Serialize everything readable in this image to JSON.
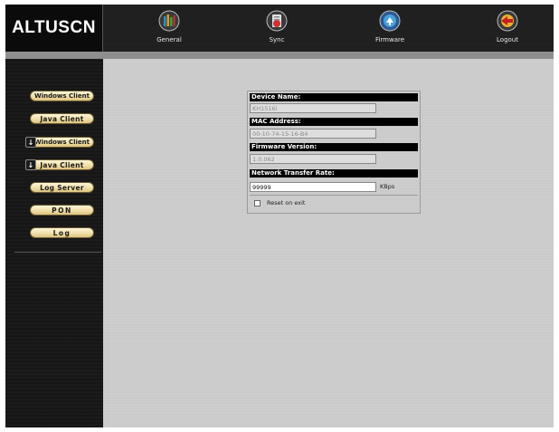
{
  "brand": {
    "logo_text": "ALTUSCN"
  },
  "topnav": [
    {
      "label": "General",
      "icon": "general-icon",
      "color": "#2d8cc8"
    },
    {
      "label": "Sync",
      "icon": "sync-icon",
      "color": "#d03030"
    },
    {
      "label": "Firmware",
      "icon": "firmware-icon",
      "color": "#4aa0d8"
    },
    {
      "label": "Logout",
      "icon": "logout-icon",
      "color": "#e07a20"
    }
  ],
  "sidebar": {
    "items": [
      {
        "label": "Windows Client",
        "download": false
      },
      {
        "label": "Java Client",
        "download": false
      },
      {
        "label": "Windows Client",
        "download": true
      },
      {
        "label": "Java Client",
        "download": true
      },
      {
        "label": "Log Server",
        "download": false
      },
      {
        "label": "PON",
        "download": false
      },
      {
        "label": "Log",
        "download": false
      }
    ]
  },
  "form": {
    "device_name_label": "Device Name:",
    "device_name_value": "KH1516i",
    "mac_label": "MAC Address:",
    "mac_value": "00-10-74-15-16-B4",
    "firmware_label": "Firmware Version:",
    "firmware_value": "1.0.062",
    "rate_label": "Network Transfer Rate:",
    "rate_value": "99999",
    "rate_unit": "KBps",
    "reset_label": "Reset on exit",
    "reset_checked": false
  },
  "colors": {
    "button_face": "#f1dfaa",
    "topbar": "#1f1f1f",
    "field_header": "#000000"
  }
}
